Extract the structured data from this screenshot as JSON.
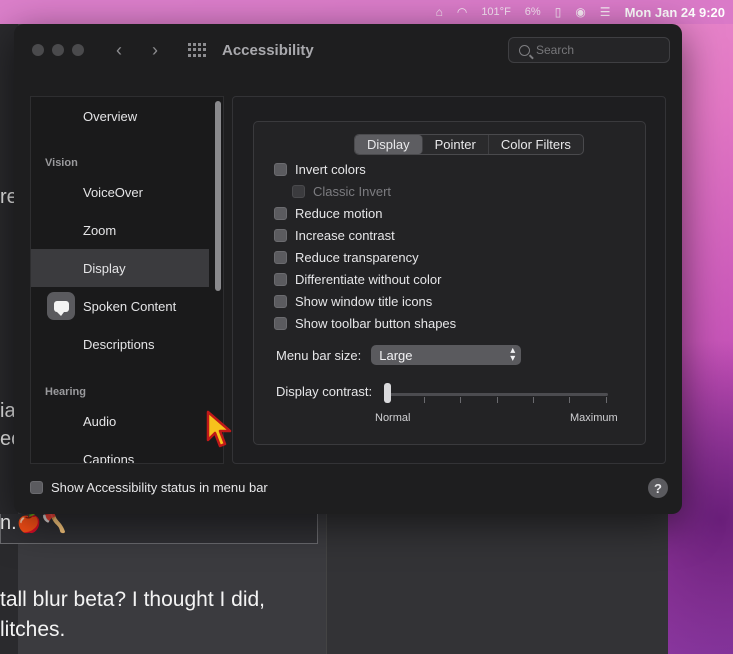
{
  "menubar": {
    "temperature": "101°F",
    "battery": "6%",
    "clock": "Mon Jan 24  9:20"
  },
  "background_window": {
    "peek_chars": [
      "re",
      "ia",
      "ec"
    ],
    "panel_text": "n.🍎🪓",
    "text_line1": "tall blur beta? I thought I did,",
    "text_line2": "litches."
  },
  "window": {
    "title": "Accessibility",
    "search_placeholder": "Search"
  },
  "sidebar": {
    "items": [
      {
        "type": "item",
        "label": "Overview"
      },
      {
        "type": "section",
        "label": "Vision"
      },
      {
        "type": "item",
        "label": "VoiceOver"
      },
      {
        "type": "item",
        "label": "Zoom"
      },
      {
        "type": "item",
        "label": "Display",
        "selected": true
      },
      {
        "type": "item",
        "label": "Spoken Content",
        "icon": "speech-bubble-icon"
      },
      {
        "type": "item",
        "label": "Descriptions"
      },
      {
        "type": "section",
        "label": "Hearing"
      },
      {
        "type": "item",
        "label": "Audio"
      },
      {
        "type": "item",
        "label": "Captions"
      }
    ]
  },
  "tabs": [
    {
      "label": "Display",
      "active": true
    },
    {
      "label": "Pointer"
    },
    {
      "label": "Color Filters"
    }
  ],
  "options": [
    {
      "label": "Invert colors",
      "checked": false
    },
    {
      "label": "Classic Invert",
      "checked": false,
      "disabled": true
    },
    {
      "label": "Reduce motion",
      "checked": false
    },
    {
      "label": "Increase contrast",
      "checked": false
    },
    {
      "label": "Reduce transparency",
      "checked": false
    },
    {
      "label": "Differentiate without color",
      "checked": false
    },
    {
      "label": "Show window title icons",
      "checked": false
    },
    {
      "label": "Show toolbar button shapes",
      "checked": false
    }
  ],
  "menu_bar_size": {
    "label": "Menu bar size:",
    "value": "Large"
  },
  "display_contrast": {
    "label": "Display contrast:",
    "min_label": "Normal",
    "max_label": "Maximum",
    "value": 0
  },
  "footer": {
    "status_label": "Show Accessibility status in menu bar",
    "help": "?"
  }
}
